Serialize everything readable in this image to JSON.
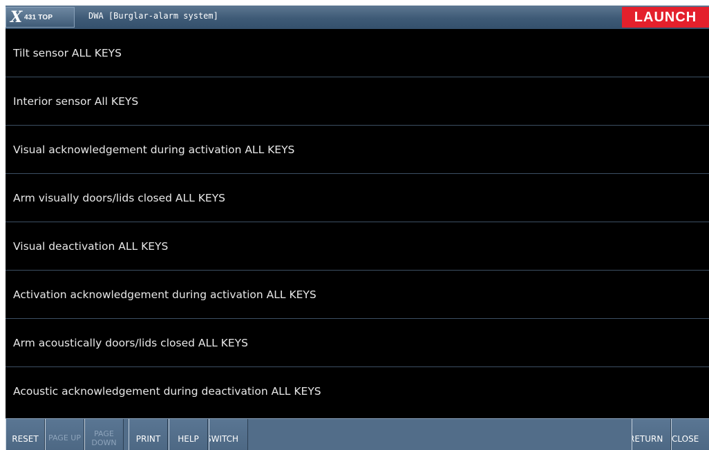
{
  "header": {
    "logo_text": "431 TOP",
    "title": "DWA [Burglar-alarm system]",
    "brand": "LAUNCH",
    "brand_color": "#e4202c"
  },
  "list": {
    "items": [
      {
        "label": "Tilt sensor ALL KEYS"
      },
      {
        "label": "Interior sensor All KEYS"
      },
      {
        "label": "Visual acknowledgement during activation ALL KEYS"
      },
      {
        "label": "Arm visually doors/lids closed ALL KEYS"
      },
      {
        "label": "Visual deactivation ALL KEYS"
      },
      {
        "label": "Activation acknowledgement during activation ALL KEYS"
      },
      {
        "label": "Arm acoustically doors/lids closed ALL KEYS"
      },
      {
        "label": "Acoustic acknowledgement during deactivation ALL KEYS"
      }
    ]
  },
  "toolbar": {
    "reset": "RESET",
    "page_up": "PAGE UP",
    "page_down": "PAGE DOWN",
    "print": "PRINT",
    "help": "HELP",
    "switch": "SWITCH",
    "return": "RETURN",
    "close": "CLOSE"
  },
  "icons": {
    "logo": "x431-logo-icon"
  }
}
